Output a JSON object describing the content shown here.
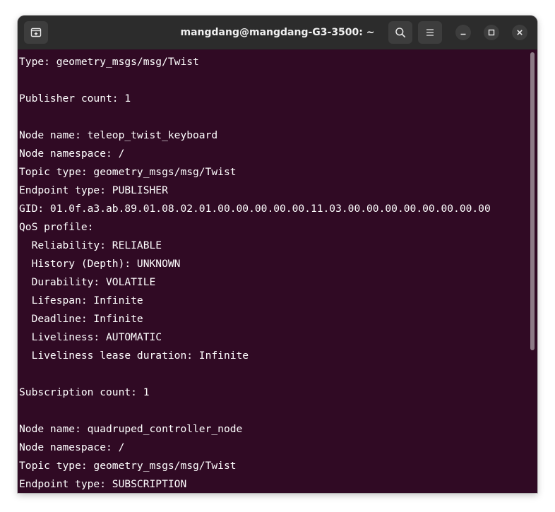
{
  "window": {
    "title": "mangdang@mangdang-G3-3500: ~"
  },
  "icons": {
    "new_tab": "new-tab-icon",
    "search": "search-icon",
    "menu": "hamburger-menu-icon",
    "minimize": "minimize-icon",
    "maximize": "maximize-icon",
    "close": "close-icon"
  },
  "colors": {
    "terminal_background": "#300a24",
    "terminal_text": "#ffffff",
    "titlebar_background": "#2c2c2c"
  },
  "terminal": {
    "lines": [
      "Type: geometry_msgs/msg/Twist",
      "",
      "Publisher count: 1",
      "",
      "Node name: teleop_twist_keyboard",
      "Node namespace: /",
      "Topic type: geometry_msgs/msg/Twist",
      "Endpoint type: PUBLISHER",
      "GID: 01.0f.a3.ab.89.01.08.02.01.00.00.00.00.00.11.03.00.00.00.00.00.00.00.00",
      "QoS profile:",
      "  Reliability: RELIABLE",
      "  History (Depth): UNKNOWN",
      "  Durability: VOLATILE",
      "  Lifespan: Infinite",
      "  Deadline: Infinite",
      "  Liveliness: AUTOMATIC",
      "  Liveliness lease duration: Infinite",
      "",
      "Subscription count: 1",
      "",
      "Node name: quadruped_controller_node",
      "Node namespace: /",
      "Topic type: geometry_msgs/msg/Twist",
      "Endpoint type: SUBSCRIPTION"
    ]
  }
}
